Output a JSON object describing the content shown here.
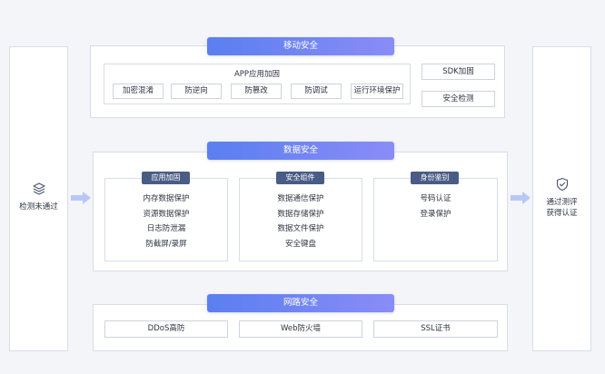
{
  "left_panel": {
    "label": "检测未通过",
    "icon": "layers-icon"
  },
  "right_panel": {
    "label_lines": [
      "通过测评",
      "获得认证"
    ],
    "icon": "shield-check-icon"
  },
  "mobile_security": {
    "title": "移动安全",
    "app_hardening": {
      "title": "APP应用加固",
      "items": [
        "加密混淆",
        "防逆向",
        "防篡改",
        "防调试",
        "运行环境保护"
      ]
    },
    "side_items": [
      "SDK加固",
      "安全检测"
    ]
  },
  "data_security": {
    "title": "数据安全",
    "groups": [
      {
        "title": "应用加固",
        "items": [
          "内存数据保护",
          "资源数据保护",
          "日志防泄漏",
          "防截屏/录屏"
        ]
      },
      {
        "title": "安全组件",
        "items": [
          "数据通信保护",
          "数据存储保护",
          "数据文件保护",
          "安全键盘"
        ]
      },
      {
        "title": "身份鉴别",
        "items": [
          "号码认证",
          "登录保护"
        ]
      }
    ]
  },
  "network_security": {
    "title": "网路安全",
    "items": [
      "DDoS高防",
      "Web防火墙",
      "SSL证书"
    ]
  },
  "colors": {
    "pill_gradient_start": "#5a7ff0",
    "pill_gradient_end": "#8a8cf6",
    "sub_pill": "#4a5c86",
    "arrow": "#b9c7f5",
    "border": "#d8dde6",
    "background": "#f3f5f9"
  }
}
